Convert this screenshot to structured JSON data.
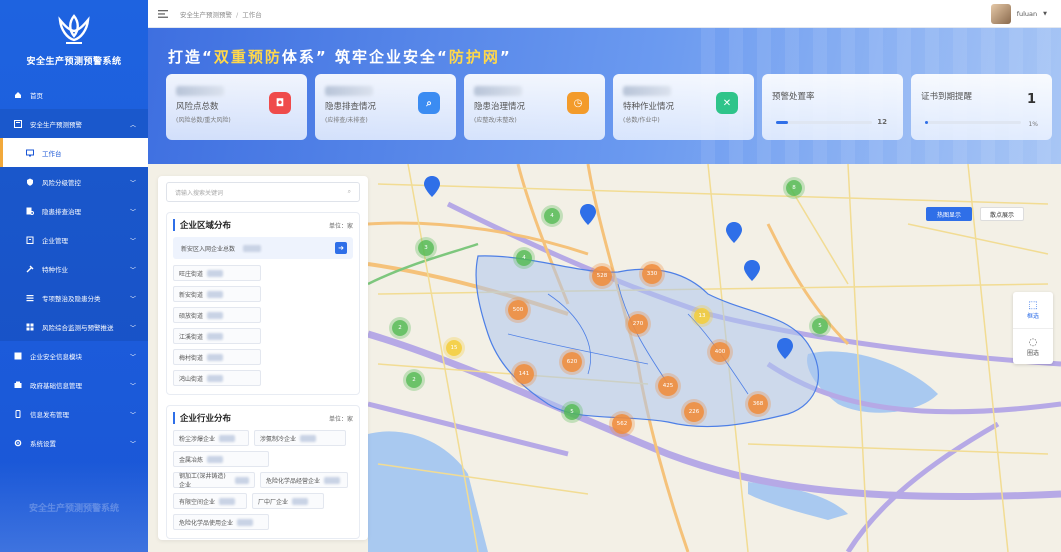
{
  "app": {
    "title": "安全生产预测预警系统"
  },
  "sidebar": {
    "items": [
      {
        "label": "首页",
        "icon": "home-icon"
      },
      {
        "label": "安全生产预测预警",
        "icon": "monitor-icon"
      },
      {
        "label": "工作台",
        "icon": "desk-icon",
        "active": true
      },
      {
        "label": "风险分级管控",
        "icon": "shield-icon"
      },
      {
        "label": "隐患排查治理",
        "icon": "search-doc-icon"
      },
      {
        "label": "企业管理",
        "icon": "building-icon"
      },
      {
        "label": "特种作业",
        "icon": "tool-icon"
      },
      {
        "label": "专项整治及隐患分类",
        "icon": "list-icon"
      },
      {
        "label": "风险综合监测与预警推送",
        "icon": "radar-icon"
      },
      {
        "label": "企业安全信息模块",
        "icon": "info-icon"
      },
      {
        "label": "政府基础信息管理",
        "icon": "gov-icon"
      },
      {
        "label": "信息发布管理",
        "icon": "phone-icon"
      },
      {
        "label": "系统设置",
        "icon": "gear-icon"
      }
    ]
  },
  "header": {
    "breadcrumb": [
      "安全生产预测预警",
      "工作台"
    ],
    "user_name": "fuluan"
  },
  "banner": {
    "slogan_a": "打造“",
    "slogan_b": "双重预防",
    "slogan_c": "体系”  筑牢企业安全“",
    "slogan_d": "防护网",
    "slogan_e": "”"
  },
  "stats": [
    {
      "title": "风险点总数",
      "sub": "(风险总数/重大风险)",
      "color": "#ef4b4b",
      "icon": "risk-icon"
    },
    {
      "title": "隐患排查情况",
      "sub": "(应排查/未排查)",
      "color": "#3b8cf2",
      "icon": "inspect-icon"
    },
    {
      "title": "隐患治理情况",
      "sub": "(应整改/未整改)",
      "color": "#f39b2b",
      "icon": "fix-icon"
    },
    {
      "title": "特种作业情况",
      "sub": "(总数/作业中)",
      "color": "#2fc48a",
      "icon": "work-icon"
    },
    {
      "title": "预警处置率",
      "value": "12",
      "progress": 0.12
    },
    {
      "title": "证书到期提醒",
      "value": "1",
      "pct": "1%",
      "progress": 0.01
    }
  ],
  "map": {
    "btn_heat": "热图显示",
    "btn_normal": "散点展示",
    "tool_select": "框选",
    "tool_circle": "圈选",
    "clusters": [
      {
        "n": "4"
      },
      {
        "n": "3"
      },
      {
        "n": "4"
      },
      {
        "n": "2"
      },
      {
        "n": "5"
      },
      {
        "n": "5"
      },
      {
        "n": "8"
      },
      {
        "n": "2"
      },
      {
        "n": "13"
      },
      {
        "n": "15"
      },
      {
        "n": "528"
      },
      {
        "n": "330"
      },
      {
        "n": "270"
      },
      {
        "n": "500"
      },
      {
        "n": "400"
      },
      {
        "n": "141"
      },
      {
        "n": "620"
      },
      {
        "n": "425"
      },
      {
        "n": "226"
      },
      {
        "n": "368"
      },
      {
        "n": "562"
      }
    ]
  },
  "panel": {
    "search_placeholder": "请输入搜索关键词",
    "region": {
      "title": "企业区域分布",
      "unit": "单位：家",
      "total_label": "新安区入网企业总数",
      "tags": [
        "旺庄街道",
        "新安街道",
        "硕放街道",
        "江溪街道",
        "梅村街道",
        "鸿山街道"
      ]
    },
    "industry": {
      "title": "企业行业分布",
      "unit": "单位：家",
      "tags": [
        "粉尘涉爆企业",
        "涉氨制冷企业",
        "金属冶炼",
        "钢加工(深井铸造)企业",
        "危险化学品经营企业",
        "有限空间企业",
        "厂中厂企业",
        "危险化学品使用企业"
      ]
    }
  }
}
